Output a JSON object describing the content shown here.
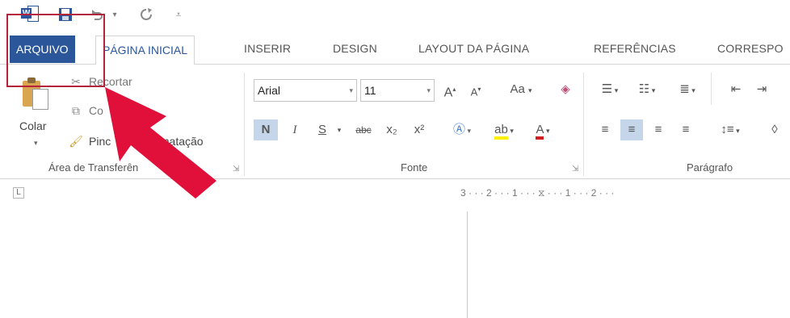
{
  "qat": {
    "word_logo_letter": "W",
    "save_icon": "save-icon",
    "undo_icon": "undo-icon",
    "redo_icon": "redo-icon",
    "customize_icon": "customize-qat-icon"
  },
  "tabs": {
    "file": "ARQUIVO",
    "home": "PÁGINA INICIAL",
    "insert": "INSERIR",
    "design": "DESIGN",
    "layout": "LAYOUT DA PÁGINA",
    "references": "REFERÊNCIAS",
    "mailings": "CORRESPO"
  },
  "clipboard": {
    "paste": "Colar",
    "cut": "Recortar",
    "copy": "Co",
    "format_painter_pre": "Pinc",
    "format_painter_post": "rmatação",
    "group_label": "Área de Transferên"
  },
  "font": {
    "name": "Arial",
    "size": "11",
    "bold": "N",
    "italic": "I",
    "underline": "S",
    "strike": "abc",
    "subscript": "x₂",
    "superscript": "x²",
    "grow": "A",
    "shrink": "A",
    "case": "Aa",
    "group_label": "Fonte"
  },
  "paragraph": {
    "group_label": "Parágrafo"
  },
  "ruler": {
    "text": "3 · · · 2 · · · 1 · · · ⧖ · · · 1 · · · 2 · · ·",
    "corner": "L"
  },
  "colors": {
    "accent": "#2b579a",
    "highlight": "#b4223d",
    "arrow": "#e0103a"
  }
}
